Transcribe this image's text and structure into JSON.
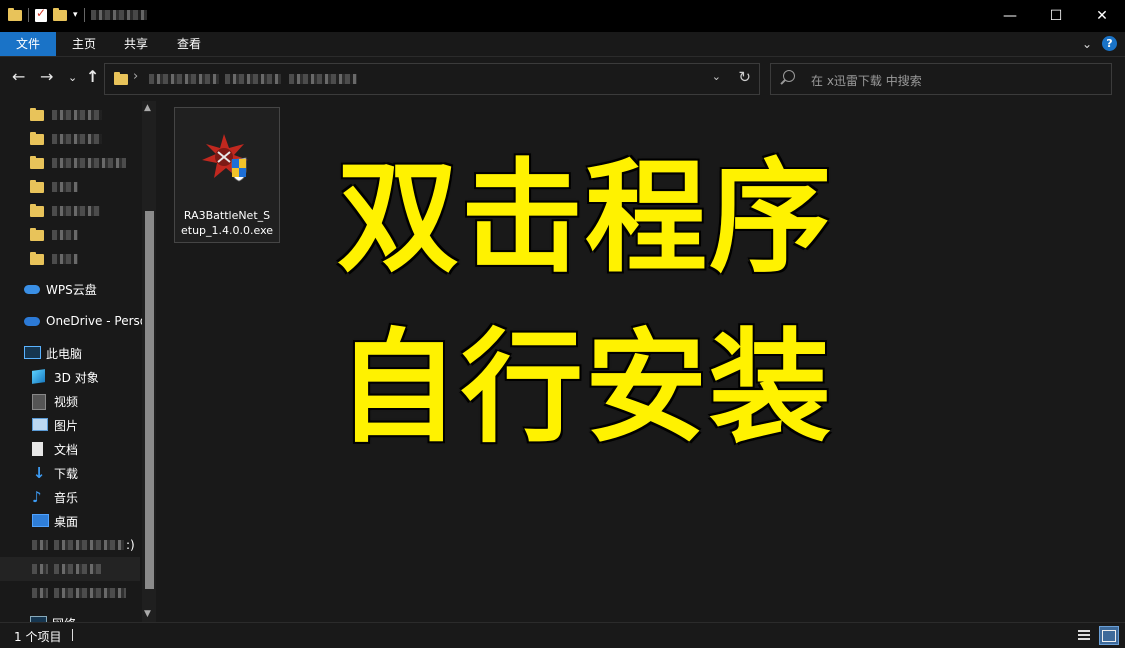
{
  "ribbon": {
    "file": "文件",
    "home": "主页",
    "share": "共享",
    "view": "查看"
  },
  "search": {
    "placeholder": "在 x迅雷下载 中搜索"
  },
  "sidebar": {
    "wps": "WPS云盘",
    "onedrive": "OneDrive - Perso",
    "thispc": "此电脑",
    "obj3d": "3D 对象",
    "videos": "视频",
    "pictures": "图片",
    "documents": "文档",
    "downloads": "下载",
    "music": "音乐",
    "desktop": "桌面",
    "drive_suffix": ":)",
    "network": "网络"
  },
  "file": {
    "name_line1": "RA3BattleNet_S",
    "name_line2": "etup_1.4.0.0.exe"
  },
  "overlay": {
    "line1": "双击程序",
    "line2": "自行安装"
  },
  "status": {
    "count": "1 个项目"
  },
  "colors": {
    "accent": "#1a73c7",
    "overlay_text": "#fff200",
    "folder": "#e8c35a"
  }
}
